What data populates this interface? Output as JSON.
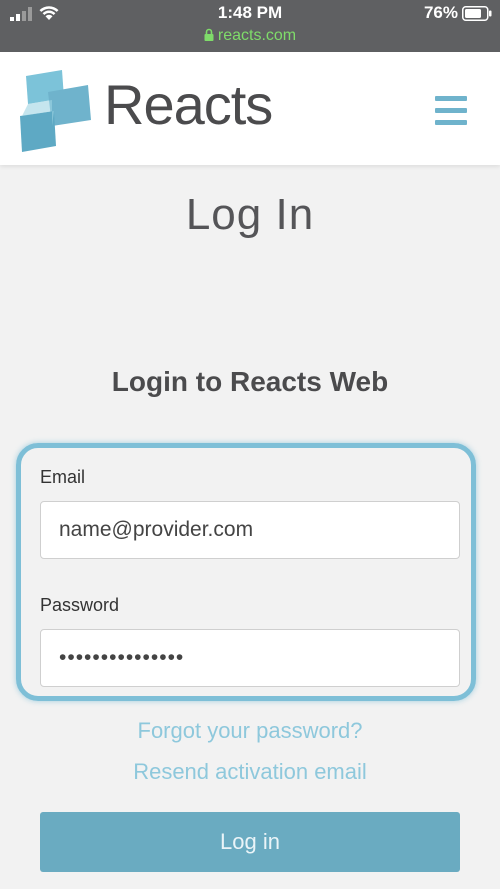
{
  "status_bar": {
    "time": "1:48 PM",
    "url": "reacts.com",
    "battery": "76%",
    "icons": [
      "signal-icon",
      "wifi-icon",
      "lock-icon",
      "battery-icon"
    ]
  },
  "header": {
    "brand": "Reacts",
    "icons": [
      "reacts-logo-icon",
      "hamburger-menu-icon"
    ]
  },
  "page": {
    "title": "Log In",
    "form_heading": "Login to Reacts Web"
  },
  "form": {
    "email_label": "Email",
    "email_value": "name@provider.com",
    "password_label": "Password",
    "password_value": "•••••••••••••••"
  },
  "links": {
    "forgot_password": "Forgot your password?",
    "resend_activation": "Resend activation email"
  },
  "actions": {
    "login_label": "Log in"
  },
  "colors": {
    "accent": "#7ebfd7",
    "button": "#6aabc1",
    "link": "#8ec8dc",
    "brand_text": "#4b4b4d",
    "status_bar": "#5f6062"
  }
}
